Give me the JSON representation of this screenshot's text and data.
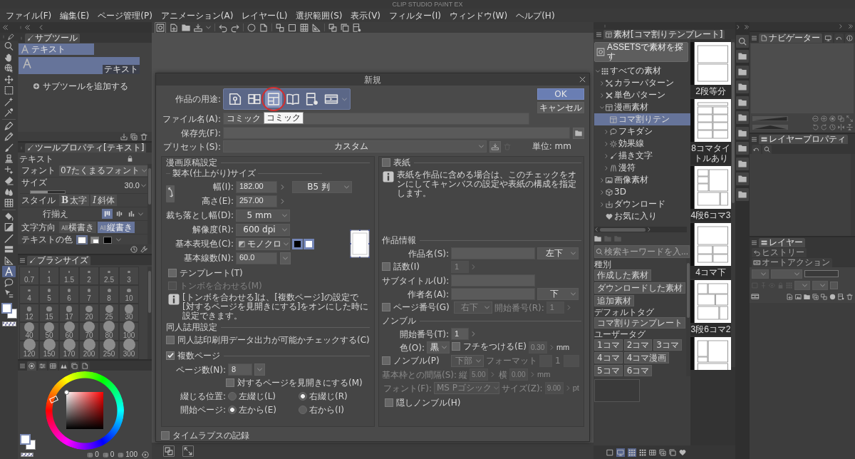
{
  "window": {
    "title": "CLIP STUDIO PAINT EX"
  },
  "menu": [
    "ファイル(F)",
    "編集(E)",
    "ページ管理(P)",
    "アニメーション(A)",
    "レイヤー(L)",
    "選択範囲(S)",
    "表示(V)",
    "フィルター(I)",
    "ウィンドウ(W)",
    "ヘルプ(H)"
  ],
  "tools": [
    {
      "selected": false
    },
    {
      "selected": false
    },
    {
      "selected": false
    },
    {
      "selected": false
    },
    {
      "selected": false
    },
    {
      "selected": false
    },
    {
      "selected": false
    },
    {
      "selected": false
    },
    {
      "selected": false
    },
    {
      "selected": false
    },
    {
      "selected": false
    },
    {
      "selected": false
    },
    {
      "selected": false
    },
    {
      "selected": false
    },
    {
      "selected": false
    },
    {
      "selected": false
    },
    {
      "selected": false
    },
    {
      "selected": false
    },
    {
      "selected": false
    },
    {
      "selected": false
    },
    {
      "selected": true
    },
    {
      "selected": false
    },
    {
      "selected": false
    }
  ],
  "sub_tool": {
    "tab": "サブツール",
    "groups": [
      {
        "label": "テキスト",
        "selected": true
      }
    ],
    "items": [
      {
        "label": "テキスト",
        "selected": true
      }
    ],
    "add": "サブツールを追加する"
  },
  "tool_property": {
    "tab": "ツールプロパティ[テキスト]",
    "title": "テキスト",
    "rows": [
      {
        "kind": "dropdown",
        "label": "フォント",
        "value": "07たくまるフォント"
      },
      {
        "kind": "slider",
        "label": "サイズ",
        "value": "30.0",
        "level": 0.5
      },
      {
        "kind": "toggles",
        "label": "スタイル",
        "options": [
          {
            "glyph": "B",
            "label": "太字",
            "selected": false
          },
          {
            "glyph": "I",
            "label": "斜体",
            "selected": false
          }
        ]
      },
      {
        "kind": "icons",
        "label": "行揃え",
        "options": [
          {
            "selected": true
          },
          {
            "selected": false
          },
          {
            "selected": false
          }
        ]
      },
      {
        "kind": "toggles",
        "label": "文字方向",
        "options": [
          {
            "label": "横書き",
            "selected": false
          },
          {
            "label": "縦書き",
            "selected": true
          }
        ]
      },
      {
        "kind": "swatches",
        "label": "テキストの色",
        "swatches": [
          {
            "color": "#ffffff",
            "selected": true
          },
          {
            "color": "#ffffff",
            "selected": false
          },
          {
            "color": "#000000",
            "selected": false
          }
        ]
      }
    ]
  },
  "brush_size": {
    "tab": "ブラシサイズ",
    "sizes": [
      "0.7",
      "1",
      "1.5",
      "2",
      "2.5",
      "3",
      "4",
      "5",
      "6",
      "7",
      "8",
      "10",
      "12",
      "15",
      "17",
      "20",
      "25",
      "30",
      "40",
      "50",
      "60",
      "70",
      "80",
      "100",
      "120",
      "150",
      "170",
      "200",
      "250",
      "300"
    ]
  },
  "color_panel": {
    "tabs": [
      {
        "selected": true
      },
      {
        "selected": false
      },
      {
        "selected": false
      },
      {
        "selected": false
      },
      {
        "selected": false
      },
      {
        "selected": false
      }
    ],
    "readouts": [
      "0",
      "0",
      "100"
    ]
  },
  "dialog": {
    "title": "新規",
    "usage": {
      "label": "作品の用途:",
      "options": [
        {
          "selected": false,
          "annotated": false
        },
        {
          "selected": false,
          "annotated": false
        },
        {
          "selected": true,
          "annotated": true,
          "tooltip": "コミック"
        },
        {
          "selected": false,
          "annotated": false
        },
        {
          "selected": false,
          "annotated": false
        },
        {
          "selected": false,
          "annotated": false
        }
      ]
    },
    "buttons": [
      {
        "label": "OK",
        "kind": "primary"
      },
      {
        "label": "キャンセル",
        "kind": "secondary"
      }
    ],
    "file_name": {
      "label": "ファイル名(A):",
      "value": "コミック"
    },
    "save_to": {
      "label": "保存先(F):"
    },
    "preset": {
      "label": "プリセット(S):",
      "value": "カスタム"
    },
    "unit": "単位: mm",
    "manga": {
      "heading": "漫画原稿設定",
      "subheading": "製本(仕上がり)サイズ",
      "width": {
        "label": "幅(I):",
        "value": "182.00",
        "paper": "B5 判"
      },
      "height": {
        "label": "高さ(E):",
        "value": "257.00"
      },
      "bleed": {
        "label": "裁ち落とし幅(D):",
        "value": "5 mm"
      },
      "resolution": {
        "label": "解像度(R):",
        "value": "600 dpi"
      },
      "color_mode": {
        "label": "基本表現色(C):",
        "value": "モノクロ",
        "swatches": [
          {
            "color": "#000000"
          },
          {
            "color": "#ffffff"
          }
        ]
      },
      "screen": {
        "label": "基本線数(N):",
        "value": "60.0"
      },
      "template": {
        "label": "テンプレート(T)",
        "checked": false
      },
      "crop_marks": {
        "label": "トンボを合わせる(M)",
        "checked": false,
        "disabled": true
      },
      "crop_info": "[トンボを合わせる]は、[複数ページ]の設定で[対するページを見開きにする]をオンにした時に設定できます。",
      "doujin_heading": "同人誌用設定",
      "doujin_check": {
        "label": "同人誌印刷用データ出力が可能かチェックする(C)",
        "checked": false
      },
      "multi_page": {
        "label": "複数ページ",
        "checked": true
      },
      "pages": {
        "label": "ページ数(N):",
        "value": "8"
      },
      "spread": {
        "label": "対するページを見開きにする(M)",
        "checked": false
      },
      "binding": {
        "label": "綴じる位置:",
        "options": [
          {
            "label": "左綴じ(L)",
            "selected": false
          },
          {
            "label": "右綴じ(R)",
            "selected": true
          }
        ]
      },
      "start_page": {
        "label": "開始ページ:",
        "options": [
          {
            "label": "左から(E)",
            "selected": true
          },
          {
            "label": "右から(I)",
            "selected": false
          }
        ]
      }
    },
    "cover": {
      "label": "表紙",
      "checked": false,
      "info": "表紙を作品に含める場合は、このチェックをオンにしてキャンバスの設定や表紙の構成を指定します。"
    },
    "work_info": {
      "heading": "作品情報",
      "title": {
        "label": "作品名(S):",
        "position": "左下"
      },
      "episode": {
        "label": "話数(I)",
        "checked": false,
        "value": "1"
      },
      "subtitle": {
        "label": "サブタイトル(U):"
      },
      "author": {
        "label": "作者名(A):",
        "position": "下"
      },
      "page_number": {
        "label": "ページ番号(G)",
        "checked": false,
        "position": "右下",
        "start_label": "開始番号(R):",
        "start": "1"
      }
    },
    "nombre": {
      "heading": "ノンブル",
      "start": {
        "label": "開始番号(T):",
        "value": "1"
      },
      "color": {
        "label": "色(O):",
        "value": "黒"
      },
      "border": {
        "label": "フチをつける(E)",
        "checked": false,
        "value": "0.30",
        "unit": "mm"
      },
      "show": {
        "label": "ノンブル(P)",
        "checked": false,
        "position": "下部",
        "format_label": "フォーマット",
        "format_value": "1"
      },
      "spacing": {
        "label": "基本枠との間隔(S):",
        "vertical_label": "縦",
        "vertical": "5.00",
        "horizontal_label": "横",
        "horizontal": "0.00",
        "unit": "mm"
      },
      "font": {
        "label": "フォント(F):",
        "value": "MS Pゴシック",
        "size_label": "サイズ(Z):",
        "size": "9.00",
        "unit": "pt"
      },
      "hidden": {
        "label": "隠しノンブル(H)",
        "checked": false
      }
    },
    "timelapse": {
      "label": "タイムラプスの記録",
      "checked": false
    }
  },
  "materials": {
    "tab": "素材[コマ割りテンプレート]",
    "assets_button": "ASSETSで素材を探す",
    "tree": [
      {
        "label": "すべての素材",
        "expanded": true,
        "selected": false,
        "children": [
          {
            "label": "カラーパターン",
            "expanded": false,
            "selected": false
          },
          {
            "label": "単色パターン",
            "expanded": false,
            "selected": false
          },
          {
            "label": "漫画素材",
            "expanded": true,
            "selected": false,
            "children": [
              {
                "label": "コマ割りテン",
                "selected": true
              },
              {
                "label": "フキダシ",
                "expanded": false,
                "selected": false
              },
              {
                "label": "効果線",
                "expanded": false,
                "selected": false
              },
              {
                "label": "描き文字",
                "expanded": false,
                "selected": false
              },
              {
                "label": "漫符",
                "expanded": false,
                "selected": false
              }
            ]
          },
          {
            "label": "画像素材",
            "expanded": false,
            "selected": false
          },
          {
            "label": "3D",
            "expanded": false,
            "selected": false
          },
          {
            "label": "ダウンロード",
            "expanded": false,
            "selected": false
          },
          {
            "label": "お気に入り",
            "selected": false
          }
        ]
      }
    ],
    "search": {
      "placeholder": "検索キーワードを入..."
    },
    "tag_groups": [
      {
        "heading": "種別",
        "tags": [
          "作成した素材",
          "ダウンロードした素材",
          "追加素材"
        ]
      },
      {
        "heading": "デフォルトタグ",
        "tags": [
          "コマ割りテンプレート"
        ]
      },
      {
        "heading": "ユーザータグ",
        "tags": [
          "1コマ",
          "2コマ",
          "3コマ",
          "4コマ",
          "4コマ漫画",
          "5コマ",
          "6コマ"
        ]
      }
    ],
    "thumbnails": [
      {
        "label": "2段等分"
      },
      {
        "label": "8コマタイトルあり"
      },
      {
        "label": "4段6コマ3"
      },
      {
        "label": "4コマ下"
      },
      {
        "label": "3段6コマ2"
      }
    ]
  },
  "navigator": {
    "tabs": [
      {
        "label": "ナビゲーター",
        "selected": true
      },
      {
        "selected": false
      },
      {
        "selected": false
      },
      {
        "selected": false
      }
    ]
  },
  "layer_property": {
    "tabs": [
      {
        "label": "レイヤープロパティ",
        "selected": true
      },
      {
        "selected": false
      },
      {
        "selected": false
      }
    ]
  },
  "layers": {
    "tabs": [
      {
        "label": "レイヤー",
        "selected": true
      },
      {
        "label": "ヒストリー",
        "selected": false
      },
      {
        "label": "オートアクション",
        "selected": false
      }
    ]
  }
}
